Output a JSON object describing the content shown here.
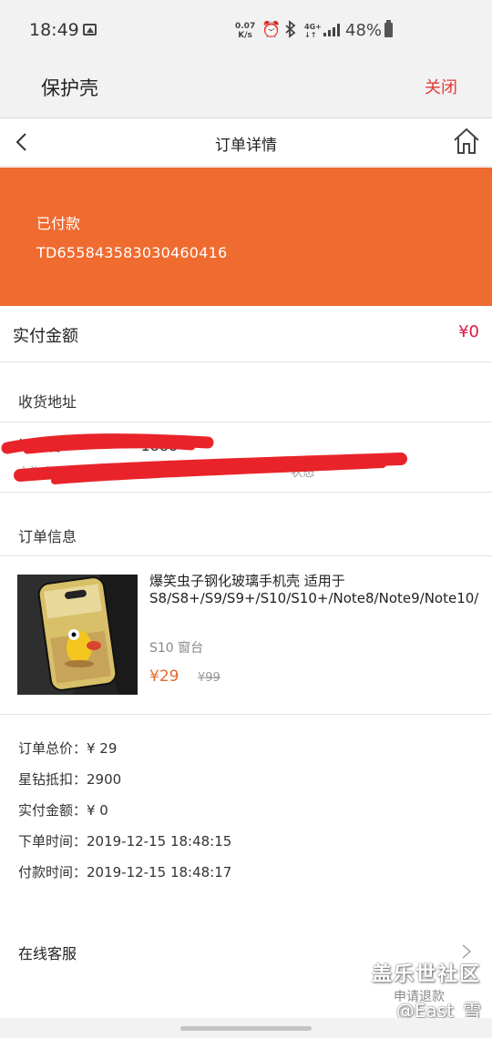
{
  "status_bar": {
    "time": "18:49",
    "speed_value": "0.07",
    "speed_unit": "K/s",
    "network": "4G+",
    "battery": "48%"
  },
  "app_bar": {
    "title": "保护壳",
    "close_label": "关闭"
  },
  "nav_bar": {
    "title": "订单详情"
  },
  "order_banner": {
    "status": "已付款",
    "order_id": "TD655843583030460416"
  },
  "paid_row": {
    "label": "实付金额",
    "value": "¥0"
  },
  "address_section": {
    "title": "收货地址"
  },
  "order_info_section": {
    "title": "订单信息"
  },
  "product": {
    "name": "爆笑虫子钢化玻璃手机壳 适用于S8/S8+/S9/S9+/S10/S10+/Note8/Note9/Note10/",
    "spec": "S10 窗台",
    "price": "¥29",
    "original_price": "¥99"
  },
  "summary": {
    "total": "订单总价：¥ 29",
    "star_deduction": "星钻抵扣：2900",
    "actual_paid": "实付金额：¥ 0",
    "order_time": "下单时间：2019-12-15 18:48:15",
    "pay_time": "付款时间：2019-12-15 18:48:17"
  },
  "service": {
    "label": "在线客服"
  },
  "watermark": {
    "community": "盖乐世社区",
    "refund_label": "申请退款",
    "author": "@East_雪"
  },
  "colors": {
    "banner": "#ef6b2f",
    "close_text": "#e53935",
    "price": "#e06a2a",
    "paid_value": "#d81b4a"
  }
}
